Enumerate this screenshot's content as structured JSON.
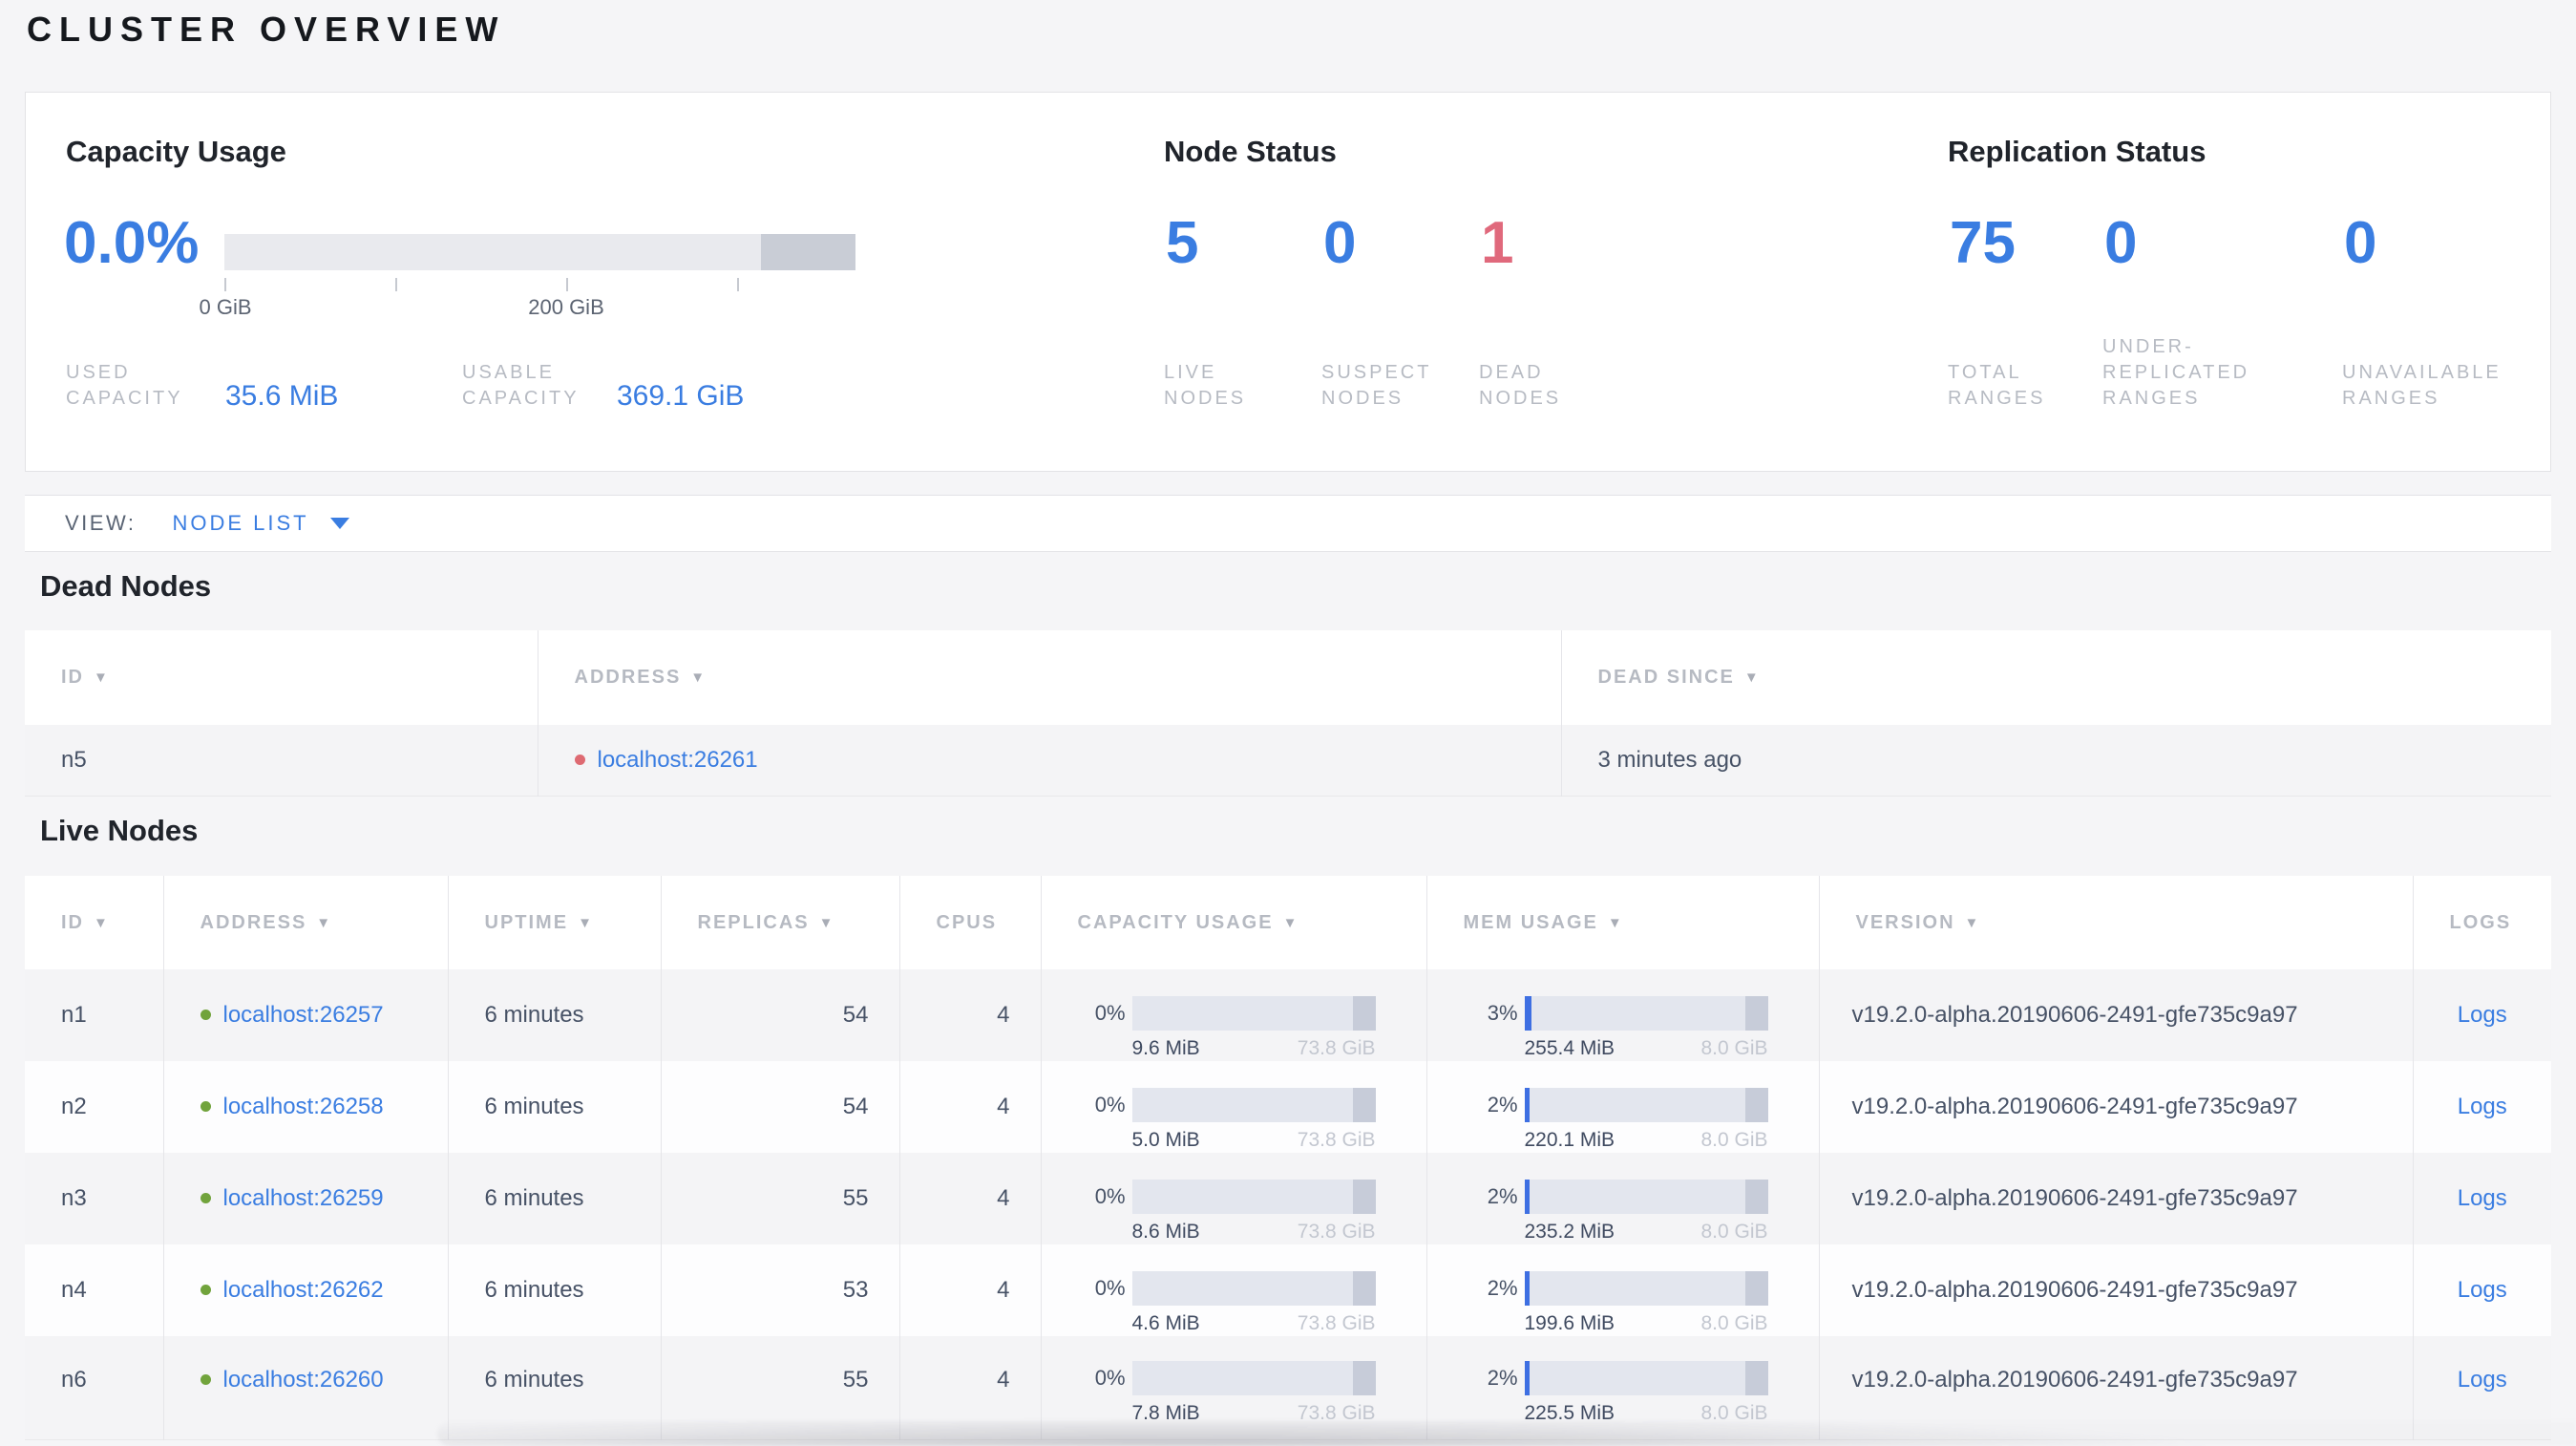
{
  "page": {
    "title": "CLUSTER OVERVIEW"
  },
  "summary": {
    "capacity": {
      "title": "Capacity Usage",
      "percent": "0.0%",
      "axis_tick_0": "0 GiB",
      "axis_tick_200": "200 GiB",
      "used_label": "USED CAPACITY",
      "used_value": "35.6 MiB",
      "usable_label": "USABLE CAPACITY",
      "usable_value": "369.1 GiB"
    },
    "node_status": {
      "title": "Node Status",
      "live": {
        "value": "5",
        "label": "LIVE NODES"
      },
      "suspect": {
        "value": "0",
        "label": "SUSPECT NODES"
      },
      "dead": {
        "value": "1",
        "label": "DEAD NODES"
      }
    },
    "replication": {
      "title": "Replication Status",
      "total": {
        "value": "75",
        "label": "TOTAL RANGES"
      },
      "under_replicated": {
        "value": "0",
        "label": "UNDER-REPLICATED RANGES"
      },
      "unavailable": {
        "value": "0",
        "label": "UNAVAILABLE RANGES"
      }
    }
  },
  "view_bar": {
    "label": "VIEW:",
    "selected": "NODE LIST"
  },
  "dead_nodes": {
    "title": "Dead Nodes",
    "columns": [
      {
        "label": "ID"
      },
      {
        "label": "ADDRESS"
      },
      {
        "label": "DEAD SINCE"
      }
    ],
    "rows": [
      {
        "id": "n5",
        "address": "localhost:26261",
        "dead_since": "3 minutes ago"
      }
    ]
  },
  "live_nodes": {
    "title": "Live Nodes",
    "columns": [
      {
        "label": "ID"
      },
      {
        "label": "ADDRESS"
      },
      {
        "label": "UPTIME"
      },
      {
        "label": "REPLICAS"
      },
      {
        "label": "CPUS"
      },
      {
        "label": "CAPACITY USAGE"
      },
      {
        "label": "MEM USAGE"
      },
      {
        "label": "VERSION"
      },
      {
        "label": "LOGS"
      }
    ],
    "rows": [
      {
        "id": "n1",
        "address": "localhost:26257",
        "uptime": "6 minutes",
        "replicas": "54",
        "cpus": "4",
        "capacity": {
          "percent": "0%",
          "percent_num": 0,
          "used": "9.6 MiB",
          "total": "73.8 GiB"
        },
        "memory": {
          "percent": "3%",
          "percent_num": 3,
          "used": "255.4 MiB",
          "total": "8.0 GiB"
        },
        "version": "v19.2.0-alpha.20190606-2491-gfe735c9a97",
        "logs_label": "Logs"
      },
      {
        "id": "n2",
        "address": "localhost:26258",
        "uptime": "6 minutes",
        "replicas": "54",
        "cpus": "4",
        "capacity": {
          "percent": "0%",
          "percent_num": 0,
          "used": "5.0 MiB",
          "total": "73.8 GiB"
        },
        "memory": {
          "percent": "2%",
          "percent_num": 2,
          "used": "220.1 MiB",
          "total": "8.0 GiB"
        },
        "version": "v19.2.0-alpha.20190606-2491-gfe735c9a97",
        "logs_label": "Logs"
      },
      {
        "id": "n3",
        "address": "localhost:26259",
        "uptime": "6 minutes",
        "replicas": "55",
        "cpus": "4",
        "capacity": {
          "percent": "0%",
          "percent_num": 0,
          "used": "8.6 MiB",
          "total": "73.8 GiB"
        },
        "memory": {
          "percent": "2%",
          "percent_num": 2,
          "used": "235.2 MiB",
          "total": "8.0 GiB"
        },
        "version": "v19.2.0-alpha.20190606-2491-gfe735c9a97",
        "logs_label": "Logs"
      },
      {
        "id": "n4",
        "address": "localhost:26262",
        "uptime": "6 minutes",
        "replicas": "53",
        "cpus": "4",
        "capacity": {
          "percent": "0%",
          "percent_num": 0,
          "used": "4.6 MiB",
          "total": "73.8 GiB"
        },
        "memory": {
          "percent": "2%",
          "percent_num": 2,
          "used": "199.6 MiB",
          "total": "8.0 GiB"
        },
        "version": "v19.2.0-alpha.20190606-2491-gfe735c9a97",
        "logs_label": "Logs"
      },
      {
        "id": "n6",
        "address": "localhost:26260",
        "uptime": "6 minutes",
        "replicas": "55",
        "cpus": "4",
        "capacity": {
          "percent": "0%",
          "percent_num": 0,
          "used": "7.8 MiB",
          "total": "73.8 GiB"
        },
        "memory": {
          "percent": "2%",
          "percent_num": 2,
          "used": "225.5 MiB",
          "total": "8.0 GiB"
        },
        "version": "v19.2.0-alpha.20190606-2491-gfe735c9a97",
        "logs_label": "Logs"
      }
    ]
  },
  "colors": {
    "accent_blue": "#3a7de1",
    "bar_fill_blue": "#3e6fe2",
    "danger_red": "#e0697c",
    "live_green": "#71a33c",
    "dead_dot_red": "#de6a72"
  }
}
